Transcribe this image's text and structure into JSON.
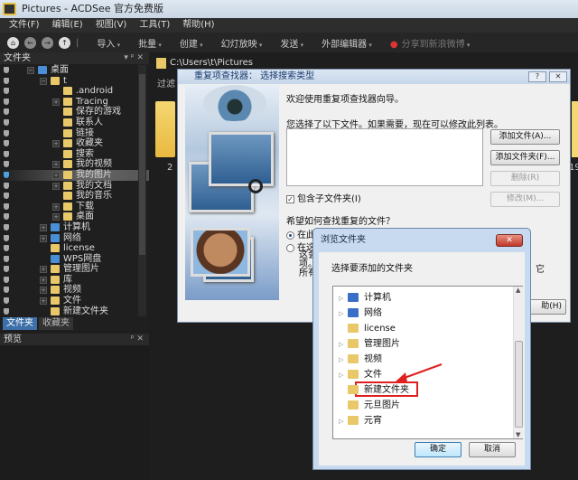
{
  "window": {
    "title": "Pictures - ACDSee 官方免费版"
  },
  "menu": [
    "文件(F)",
    "编辑(E)",
    "视图(V)",
    "工具(T)",
    "帮助(H)"
  ],
  "toolbar": {
    "items": [
      "导入",
      "批量",
      "创建",
      "幻灯放映",
      "发送",
      "外部编辑器"
    ],
    "share": "分享到新浪微博"
  },
  "folders_panel": {
    "title": "文件夹",
    "controls": "▾ ᵖ ✕",
    "tree": [
      {
        "label": "桌面",
        "level": 0,
        "exp": "−",
        "icon": "desktop"
      },
      {
        "label": "t",
        "level": 1,
        "exp": "−",
        "icon": "user"
      },
      {
        "label": ".android",
        "level": 2,
        "exp": "",
        "icon": "folder"
      },
      {
        "label": "Tracing",
        "level": 2,
        "exp": "+",
        "icon": "folder"
      },
      {
        "label": "保存的游戏",
        "level": 2,
        "exp": "",
        "icon": "folder"
      },
      {
        "label": "联系人",
        "level": 2,
        "exp": "",
        "icon": "folder"
      },
      {
        "label": "链接",
        "level": 2,
        "exp": "",
        "icon": "folder"
      },
      {
        "label": "收藏夹",
        "level": 2,
        "exp": "+",
        "icon": "folder"
      },
      {
        "label": "搜索",
        "level": 2,
        "exp": "",
        "icon": "folder"
      },
      {
        "label": "我的视频",
        "level": 2,
        "exp": "+",
        "icon": "folder"
      },
      {
        "label": "我的图片",
        "level": 2,
        "exp": "+",
        "icon": "folder",
        "selected": true
      },
      {
        "label": "我的文档",
        "level": 2,
        "exp": "+",
        "icon": "folder"
      },
      {
        "label": "我的音乐",
        "level": 2,
        "exp": "",
        "icon": "folder"
      },
      {
        "label": "下载",
        "level": 2,
        "exp": "+",
        "icon": "folder"
      },
      {
        "label": "桌面",
        "level": 2,
        "exp": "+",
        "icon": "folder"
      },
      {
        "label": "计算机",
        "level": 1,
        "exp": "+",
        "icon": "computer"
      },
      {
        "label": "网络",
        "level": 1,
        "exp": "+",
        "icon": "network"
      },
      {
        "label": "license",
        "level": 1,
        "exp": "",
        "icon": "folder"
      },
      {
        "label": "WPS网盘",
        "level": 1,
        "exp": "",
        "icon": "cloud"
      },
      {
        "label": "管理图片",
        "level": 1,
        "exp": "+",
        "icon": "folder"
      },
      {
        "label": "库",
        "level": 1,
        "exp": "+",
        "icon": "folder"
      },
      {
        "label": "视频",
        "level": 1,
        "exp": "+",
        "icon": "folder"
      },
      {
        "label": "文件",
        "level": 1,
        "exp": "+",
        "icon": "folder"
      },
      {
        "label": "新建文件夹",
        "level": 1,
        "exp": "",
        "icon": "folder"
      }
    ],
    "tabs": [
      "文件夹",
      "收藏夹"
    ]
  },
  "preview_panel": {
    "title": "预览",
    "controls": "ᵖ ✕"
  },
  "browser": {
    "path": "C:\\Users\\t\\Pictures",
    "filter": "过滤",
    "thumb_labels": [
      "2",
      "19"
    ]
  },
  "dup_finder": {
    "title": "重复项查找器： 选择搜索类型",
    "help": "?",
    "close": "✕",
    "welcome": "欢迎使用重复项查找器向导。",
    "selected_label": "您选择了以下文件。如果需要，现在可以修改此列表。",
    "buttons": {
      "add_file": "添加文件(A)...",
      "add_folder": "添加文件夹(F)...",
      "delete": "删除(R)",
      "modify": "修改(M)...",
      "help": "助(H)"
    },
    "include_subfolders": "包含子文件夹(I)",
    "include_checked": true,
    "question": "希望如何查找重复的文件？",
    "option1": "在此",
    "option2": "在这",
    "desc1": "这会",
    "desc2": "项。",
    "desc3": "所有",
    "desc_tail": "它"
  },
  "browse_folder": {
    "title": "浏览文件夹",
    "close": "✕",
    "prompt": "选择要添加的文件夹",
    "items": [
      {
        "label": "计算机",
        "arrow": true,
        "icon": "computer"
      },
      {
        "label": "网络",
        "arrow": true,
        "icon": "network"
      },
      {
        "label": "license",
        "arrow": false,
        "icon": "folder"
      },
      {
        "label": "管理图片",
        "arrow": true,
        "icon": "folder"
      },
      {
        "label": "视频",
        "arrow": true,
        "icon": "folder"
      },
      {
        "label": "文件",
        "arrow": true,
        "icon": "folder"
      },
      {
        "label": "新建文件夹",
        "arrow": false,
        "icon": "folder",
        "highlighted": true
      },
      {
        "label": "元旦图片",
        "arrow": false,
        "icon": "folder"
      },
      {
        "label": "元宵",
        "arrow": true,
        "icon": "folder"
      }
    ],
    "ok": "确定",
    "cancel": "取消",
    "annotation_color": "#e02020"
  }
}
